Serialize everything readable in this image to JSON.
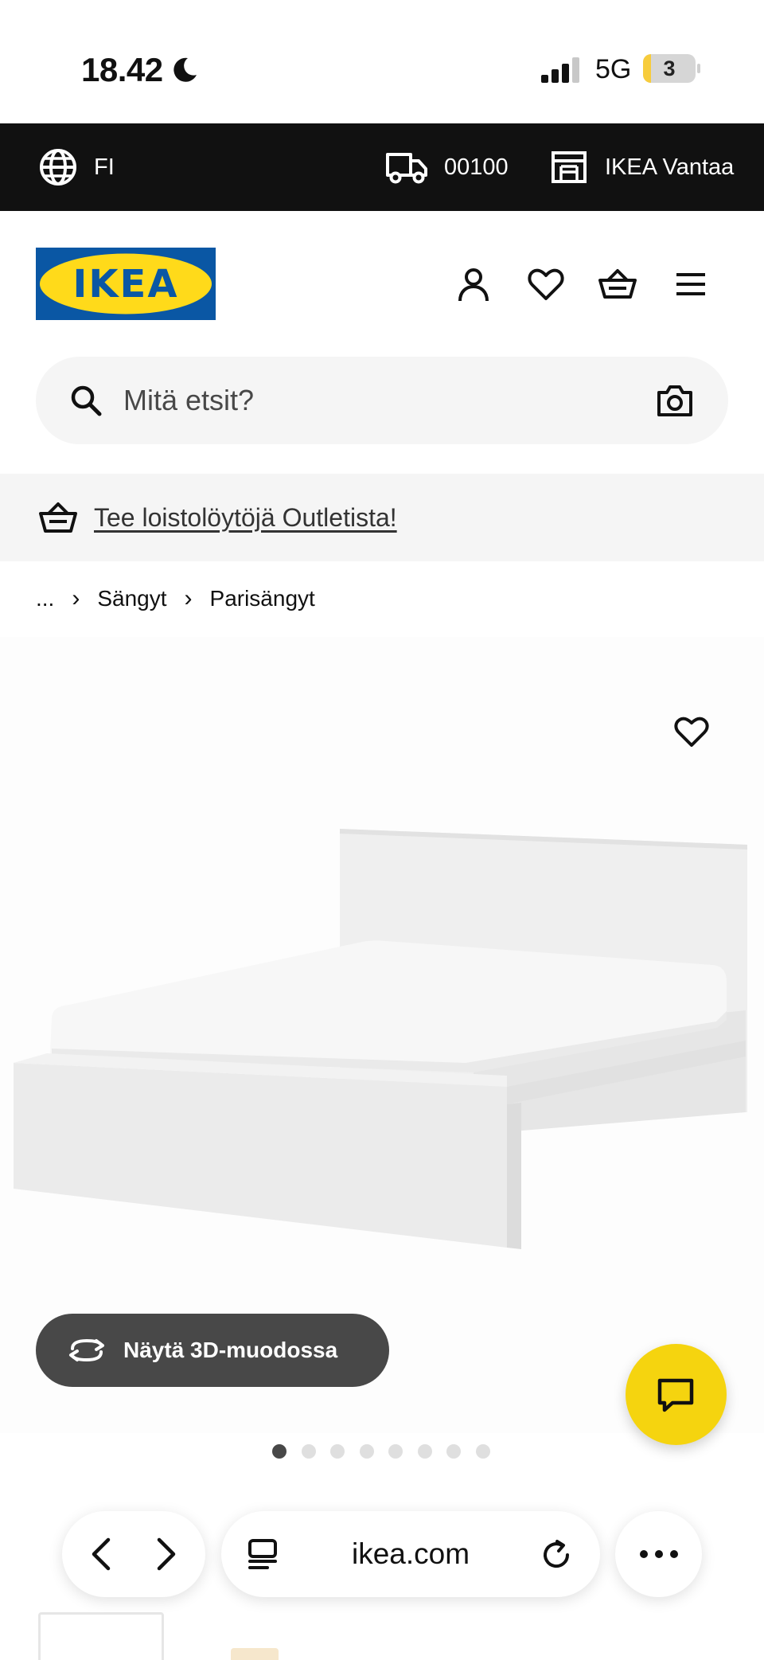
{
  "status_bar": {
    "time": "18.42",
    "network": "5G",
    "battery": "3"
  },
  "utility_bar": {
    "language": "FI",
    "postal_code": "00100",
    "store": "IKEA Vantaa"
  },
  "header": {
    "logo_text": "IKEA",
    "brand_colors": {
      "blue": "#0a57a4",
      "yellow": "#ffda1a"
    },
    "icons": [
      "user-icon",
      "heart-icon",
      "basket-icon",
      "menu-icon"
    ]
  },
  "search": {
    "placeholder": "Mitä etsit?"
  },
  "promo": {
    "link_text": "Tee loistolöytöjä Outletista!"
  },
  "breadcrumb": {
    "ellipsis": "...",
    "items": [
      "Sängyt",
      "Parisängyt"
    ]
  },
  "product": {
    "view_3d_label": "Näytä 3D-muodossa",
    "image_count": 8,
    "active_image": 1
  },
  "browser": {
    "url": "ikea.com"
  },
  "colors": {
    "utility_bar": "#111111",
    "chat_button": "#f5d40f",
    "button_3d": "#484848"
  }
}
